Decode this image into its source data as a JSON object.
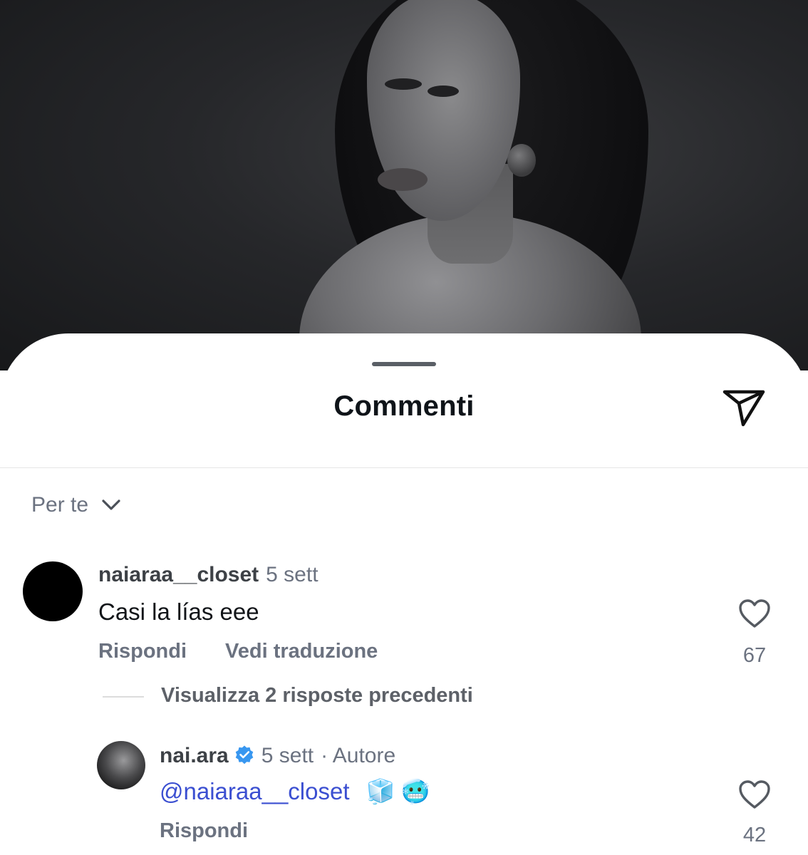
{
  "sheet": {
    "title": "Commenti",
    "send_icon": "paper-plane-icon",
    "sort_label": "Per te",
    "sort_icon": "chevron-down-icon"
  },
  "comments": [
    {
      "username": "naiaraa__closet",
      "time": "5 sett",
      "text": "Casi la lías eee",
      "reply_label": "Rispondi",
      "translate_label": "Vedi traduzione",
      "likes": "67",
      "like_icon": "heart-outline-icon"
    }
  ],
  "view_replies": "Visualizza 2 risposte precedenti",
  "reply": {
    "username": "nai.ara",
    "verified": true,
    "time": "5 sett",
    "author_label": "· Autore",
    "mention": "@naiaraa__closet",
    "emojis": "🧊🥶",
    "reply_label": "Rispondi",
    "likes": "42",
    "like_icon": "heart-outline-icon"
  },
  "colors": {
    "mention": "#3b4fd1",
    "verified_badge": "#3897f0",
    "secondary_text": "#6b7280"
  }
}
